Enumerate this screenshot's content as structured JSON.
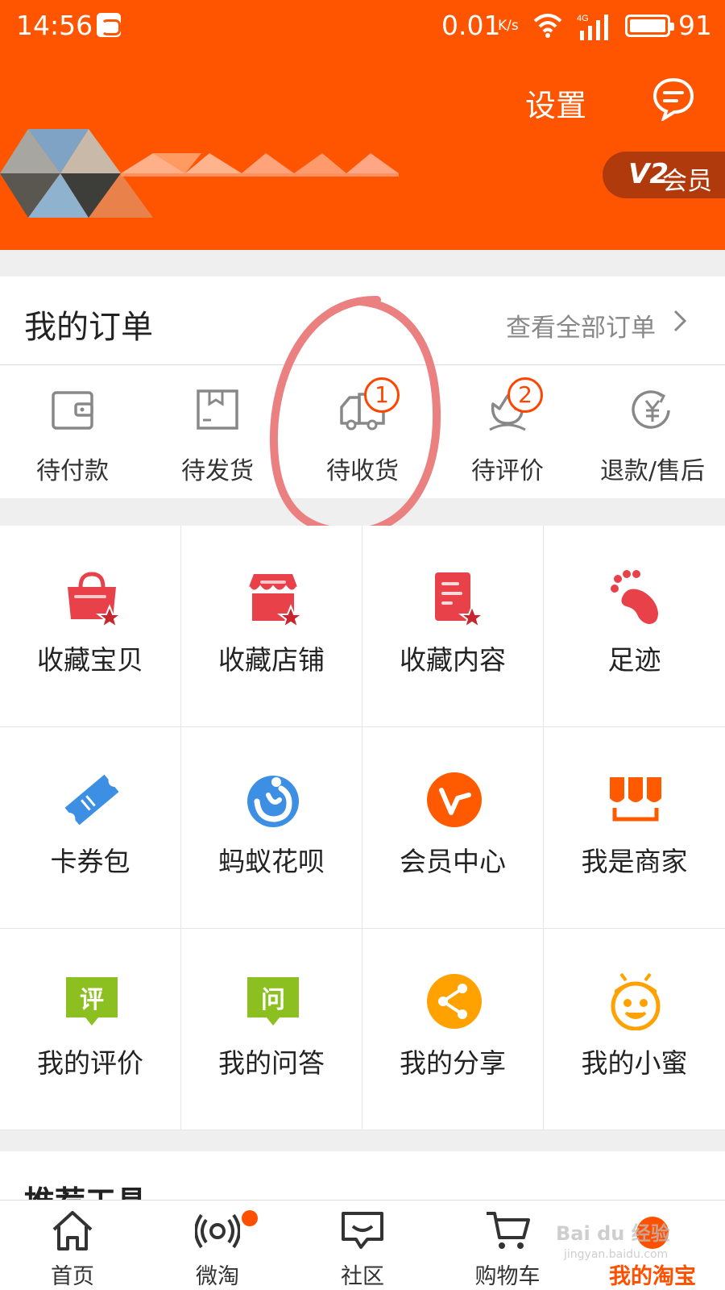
{
  "status_bar": {
    "time": "14:56",
    "network_speed": "0.01",
    "network_speed_unit": "K/s",
    "network_type": "4G",
    "battery": "91",
    "icons": [
      "notification-app-icon",
      "wifi-icon",
      "signal-icon",
      "battery-icon"
    ]
  },
  "header": {
    "settings_label": "设置",
    "message_icon": "message-icon",
    "vip_level": "V2",
    "vip_label": "会员",
    "background_color": "#ff5500"
  },
  "orders": {
    "title": "我的订单",
    "view_all_label": "查看全部订单",
    "items": [
      {
        "label": "待付款",
        "icon": "wallet-icon"
      },
      {
        "label": "待发货",
        "icon": "package-icon"
      },
      {
        "label": "待收货",
        "icon": "truck-icon",
        "badge": "1"
      },
      {
        "label": "待评价",
        "icon": "review-flower-icon",
        "badge": "2"
      },
      {
        "label": "退款/售后",
        "icon": "refund-icon"
      }
    ]
  },
  "features": [
    {
      "label": "收藏宝贝",
      "icon": "favorite-bag-icon",
      "color": "#e8414a"
    },
    {
      "label": "收藏店铺",
      "icon": "favorite-store-icon",
      "color": "#e8414a"
    },
    {
      "label": "收藏内容",
      "icon": "favorite-content-icon",
      "color": "#e8414a"
    },
    {
      "label": "足迹",
      "icon": "footprint-icon",
      "color": "#e8414a"
    },
    {
      "label": "卡券包",
      "icon": "coupon-icon",
      "color": "#3d8fe4"
    },
    {
      "label": "蚂蚁花呗",
      "icon": "huabei-icon",
      "color": "#3d8fe4"
    },
    {
      "label": "会员中心",
      "icon": "member-center-icon",
      "color": "#ff5a00"
    },
    {
      "label": "我是商家",
      "icon": "merchant-icon",
      "color": "#ff5a00"
    },
    {
      "label": "我的评价",
      "icon": "my-review-icon",
      "color": "#8cc021",
      "glyph": "评"
    },
    {
      "label": "我的问答",
      "icon": "my-qa-icon",
      "color": "#8cc021",
      "glyph": "问"
    },
    {
      "label": "我的分享",
      "icon": "share-icon",
      "color": "#ffa200"
    },
    {
      "label": "我的小蜜",
      "icon": "assistant-bee-icon",
      "color": "#ffa200"
    }
  ],
  "tools": {
    "title": "推荐工具"
  },
  "bottom_nav": [
    {
      "label": "首页",
      "icon": "home-icon"
    },
    {
      "label": "微淘",
      "icon": "broadcast-icon",
      "dot": true
    },
    {
      "label": "社区",
      "icon": "community-icon"
    },
    {
      "label": "购物车",
      "icon": "cart-icon"
    },
    {
      "label": "我的淘宝",
      "icon": "taobao-avatar-icon",
      "active": true
    }
  ],
  "watermark": {
    "text": "Bai du 经验",
    "subtext": "jingyan.baidu.com"
  },
  "accent_color": "#ff5000"
}
